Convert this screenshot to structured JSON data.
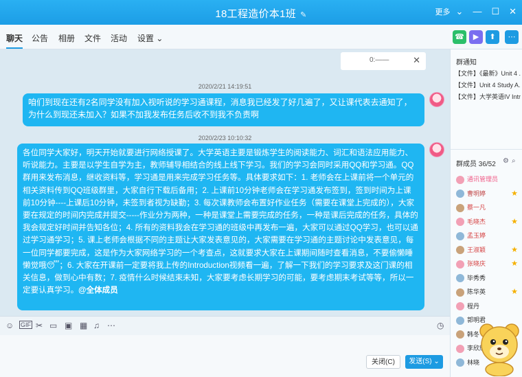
{
  "window": {
    "title": "18工程造价本1班",
    "edit_icon": "pencil-icon",
    "more_label": "更多"
  },
  "tabs": [
    "聊天",
    "公告",
    "相册",
    "文件",
    "活动",
    "设置"
  ],
  "settings_arrow": "⌄",
  "chat": {
    "float_text": "0:——",
    "messages": [
      {
        "timestamp": "2020/2/21 14:19:51",
        "text": "咱们到现在还有2名同学没有加入视听说的学习通课程，消息我已经发了好几遍了，又让课代表去通知了，为什么到现还未加入？如果不加我发布任务后收不到我不负责啊"
      },
      {
        "timestamp": "2020/2/23 10:10:32",
        "text": "各位同学大家好，明天开始就要进行网络授课了。大学英语主要是锻炼学生的阅读能力、词汇和语法应用能力、听说能力。主要是以学生自学为主，教师辅导相结合的线上线下学习。我们的学习会同时采用QQ和学习通。QQ群用来发布消息，继收资料等，学习通是用来完成学习任务等。具体要求如下：1. 老师会在上课前将一个单元的相关资料传到QQ班级群里，大家自行下载后备用；2. 上课前10分钟老师会在学习通发布签到，签到时间为上课前10分钟----上课后10分钟，未签到者视为缺勤；3. 每次课教师会布置好作业任务（需要在课堂上完成的），大家要在规定的时间内完成并提交-----作业分为两种，一种是课堂上需要完成的任务，一种是课后完成的任务，具体的我会规定好时间并告知各位；4. 所有的资料我会在学习通的班级中再发布一遍，大家可以通过QQ学习，也可以通过学习通学习；5. 课上老师会根据不同的主题让大家发表意见的，大家需要在学习通的主题讨论中发表意见，每一位同学都要完成，这是作为大家网络学习的一个考查点，这就要求大家在上课期间随时查看消息，不要偷懒睡懒觉哦",
        "text_tail": "；6. 大家在开课前一定要将我上传的Introduction视频看一遍，了解一下我们的学习要求及这门课的相关信息，做到心中有数；7. 疫情什么时候结束未知，大家要考虑长期学习的可能，要考虑期末考试等等，所以一定要认真学习。",
        "mention": "@全体成员"
      }
    ]
  },
  "input_toolbar_icons": [
    "emoji-icon",
    "gif-icon",
    "scissors-icon",
    "file-icon",
    "image-icon",
    "gallery-icon",
    "bell-icon",
    "more-icon"
  ],
  "buttons": {
    "close": "关闭(C)",
    "send": "发送(S)"
  },
  "sidebar": {
    "notice_header": "群通知",
    "notices": [
      "【文件】《最新》Unit 4 ...",
      "【文件】Unit 4 Study A...",
      "【文件】大学英语IV Intr..."
    ],
    "members_header": "群成员 36/52",
    "members": [
      {
        "name": "通讯管理员",
        "color": "#f05b86",
        "star": false
      },
      {
        "name": "曹明婷",
        "color": "#c24a4a",
        "star": true
      },
      {
        "name": "蔡一凡",
        "color": "#d64545",
        "star": false
      },
      {
        "name": "毛晓杰",
        "color": "#d64545",
        "star": true
      },
      {
        "name": "孟玉婷",
        "color": "#d64545",
        "star": false
      },
      {
        "name": "王淑颖",
        "color": "#d64545",
        "star": true
      },
      {
        "name": "张晓庆",
        "color": "#d64545",
        "star": true
      },
      {
        "name": "毕秀秀",
        "color": "#333333",
        "star": false
      },
      {
        "name": "陈华英",
        "color": "#333333",
        "star": true
      },
      {
        "name": "程丹",
        "color": "#333333",
        "star": false
      },
      {
        "name": "郭明君",
        "color": "#333333",
        "star": false
      },
      {
        "name": "韩冬",
        "color": "#333333",
        "star": false
      },
      {
        "name": "李欣欣",
        "color": "#333333",
        "star": false
      },
      {
        "name": "林晓",
        "color": "#333333",
        "star": false
      }
    ]
  },
  "colors": {
    "accent": "#1d9be2",
    "bubble": "#1fb6f2",
    "star": "#f5b000"
  }
}
